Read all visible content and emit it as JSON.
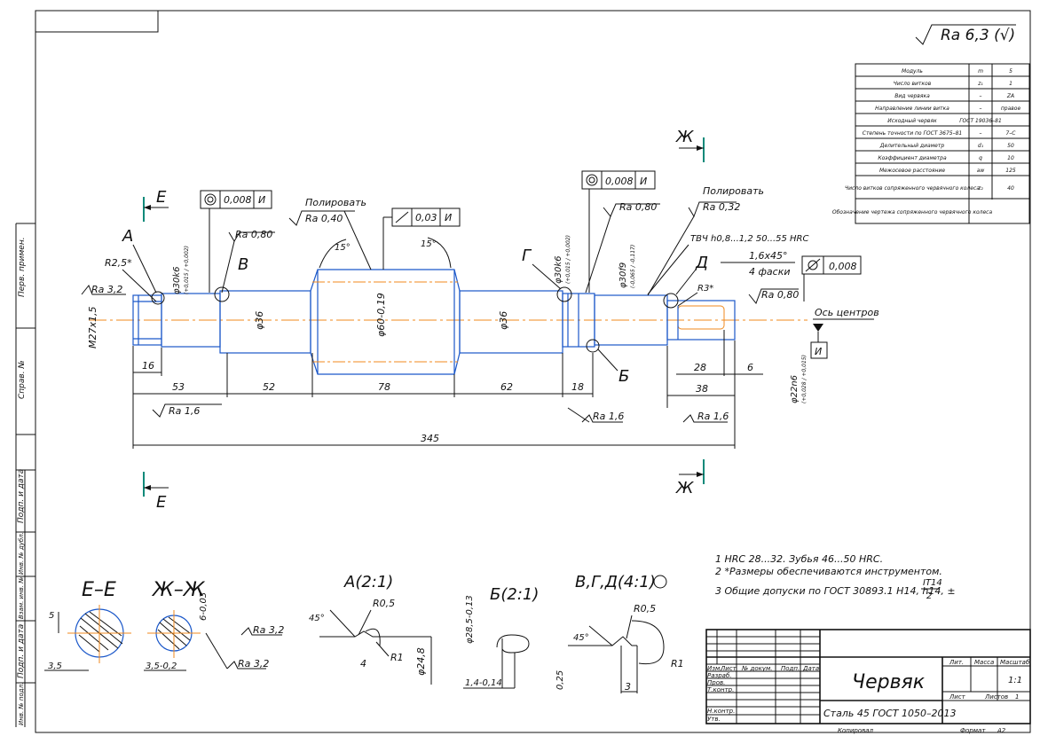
{
  "roughness_general": "Ra 6,3 (√)",
  "param_table": [
    {
      "label": "Модуль",
      "sym": "m",
      "val": "5"
    },
    {
      "label": "Число витков",
      "sym": "z₁",
      "val": "1"
    },
    {
      "label": "Вид червяка",
      "sym": "–",
      "val": "ZA"
    },
    {
      "label": "Направление линии витка",
      "sym": "–",
      "val": "правое"
    },
    {
      "label": "Исходный червяк",
      "sym": "ГОСТ 19036–81",
      "val": ""
    },
    {
      "label": "Степень точности по ГОСТ 3675–81",
      "sym": "–",
      "val": "7–С"
    },
    {
      "label": "Делительный диаметр",
      "sym": "d₁",
      "val": "50"
    },
    {
      "label": "Коэффициент диаметра",
      "sym": "q",
      "val": "10"
    },
    {
      "label": "Межосевое расстояние",
      "sym": "aw",
      "val": "125"
    },
    {
      "label": "Число витков сопряженного червячного колеса",
      "sym": "z₂",
      "val": "40"
    },
    {
      "label": "Обозначение чертежа сопряженного червячного колеса",
      "sym": "",
      "val": ""
    }
  ],
  "sections": {
    "e": "Е",
    "zh": "Ж",
    "ee": "Е–Е",
    "zhzh": "Ж–Ж"
  },
  "view_letters": {
    "a": "А",
    "b": "Б",
    "v": "В",
    "g": "Г",
    "d": "Д",
    "i": "И"
  },
  "tolerances": {
    "runout_i": "0,008",
    "angled_i": "0,03",
    "runout_i2": "0,008",
    "datum_i": "И",
    "cyl": "0,008"
  },
  "notes_polish": {
    "p1": "Полировать",
    "p2": "Полировать"
  },
  "roughness": {
    "ra32": "Ra 3,2",
    "ra04": "Ra 0,40",
    "ra08a": "Ra 0,80",
    "ra08b": "Ra 0,80",
    "ra032": "Ra 0,32",
    "ra08c": "Ra 0,80",
    "ra16a": "Ra 1,6",
    "ra16b": "Ra 1,6",
    "ra16c": "Ra 1,6",
    "ra32b": "Ra 3,2",
    "ra32c": "Ra 3,2"
  },
  "annotations": {
    "r25": "R2,5*",
    "m27": "M27x1,5",
    "phi30a": "φ30k6",
    "phi30a_tol": "(+0,015 / +0,002)",
    "phi36a": "φ36",
    "phi60": "φ60-0,19",
    "phi36b": "φ36",
    "phi30b": "φ30k6",
    "phi30b_tol": "(+0,015 / +0,002)",
    "phi30c": "φ30f9",
    "phi30c_tol": "(-0,065 / -0,117)",
    "phi22": "φ22n6",
    "phi22_tol": "(+0,028 / +0,015)",
    "tvch": "ТВЧ h0,8...1,2 50...55 HRC",
    "chamfer": "1,6x45°",
    "chamfer2": "4 фаски",
    "r3": "R3*",
    "axis_centers": "Ось центров",
    "deg15a": "15°",
    "deg15b": "15°"
  },
  "dims": {
    "d16": "16",
    "d53": "53",
    "d52": "52",
    "d78": "78",
    "d62": "62",
    "d18": "18",
    "d28": "28",
    "d6": "6",
    "d38": "38",
    "d345": "345"
  },
  "details": {
    "a_title": "А(2:1)",
    "a_r05": "R0,5",
    "a_45": "45°",
    "a_r1": "R1",
    "a_4": "4",
    "a_248": "φ24,8",
    "b_title": "Б(2:1)",
    "b_285": "φ28,5-0,13",
    "b_14": "1,4-0,14",
    "vgd_title": "В,Г,Д(4:1)",
    "vgd_r05": "R0,5",
    "vgd_45": "45°",
    "vgd_r1": "R1",
    "vgd_025": "0,25",
    "vgd_3": "3",
    "ee_5": "5",
    "ee_35": "3,5",
    "zh_6": "6-0,03",
    "zh_35": "3,5-0,2"
  },
  "notes": [
    "1  HRC 28...32. Зубья 46...50 HRC.",
    "2  *Размеры обеспечиваются инструментом.",
    "3  Общие допуски по ГОСТ 30893.1  H14, h14, ±"
  ],
  "note3_frac": {
    "num": "IT14",
    "den": "2"
  },
  "title_block": {
    "name": "Червяк",
    "material": "Сталь 45 ГОСТ 1050–2013",
    "lit": "Лит.",
    "massa": "Масса",
    "masshtab": "Масштаб",
    "scale": "1:1",
    "list": "Лист",
    "listov": "Листов",
    "listov_val": "1",
    "izm": "Изм.",
    "list2": "Лист",
    "ndokum": "№ докум.",
    "podp": "Подп.",
    "data": "Дата",
    "razrab": "Разраб.",
    "prov": "Пров.",
    "tkontr": "Т.контр.",
    "nkontr": "Н.контр.",
    "utv": "Утв.",
    "kopiroval": "Копировал",
    "format": "Формат",
    "format_val": "А2"
  },
  "side_stamp": [
    "Перв. примен.",
    "Справ. №",
    "Подп. и дата",
    "Инв. № дубл.",
    "Взам. инв. №",
    "Подп. и дата",
    "Инв. № подл."
  ]
}
